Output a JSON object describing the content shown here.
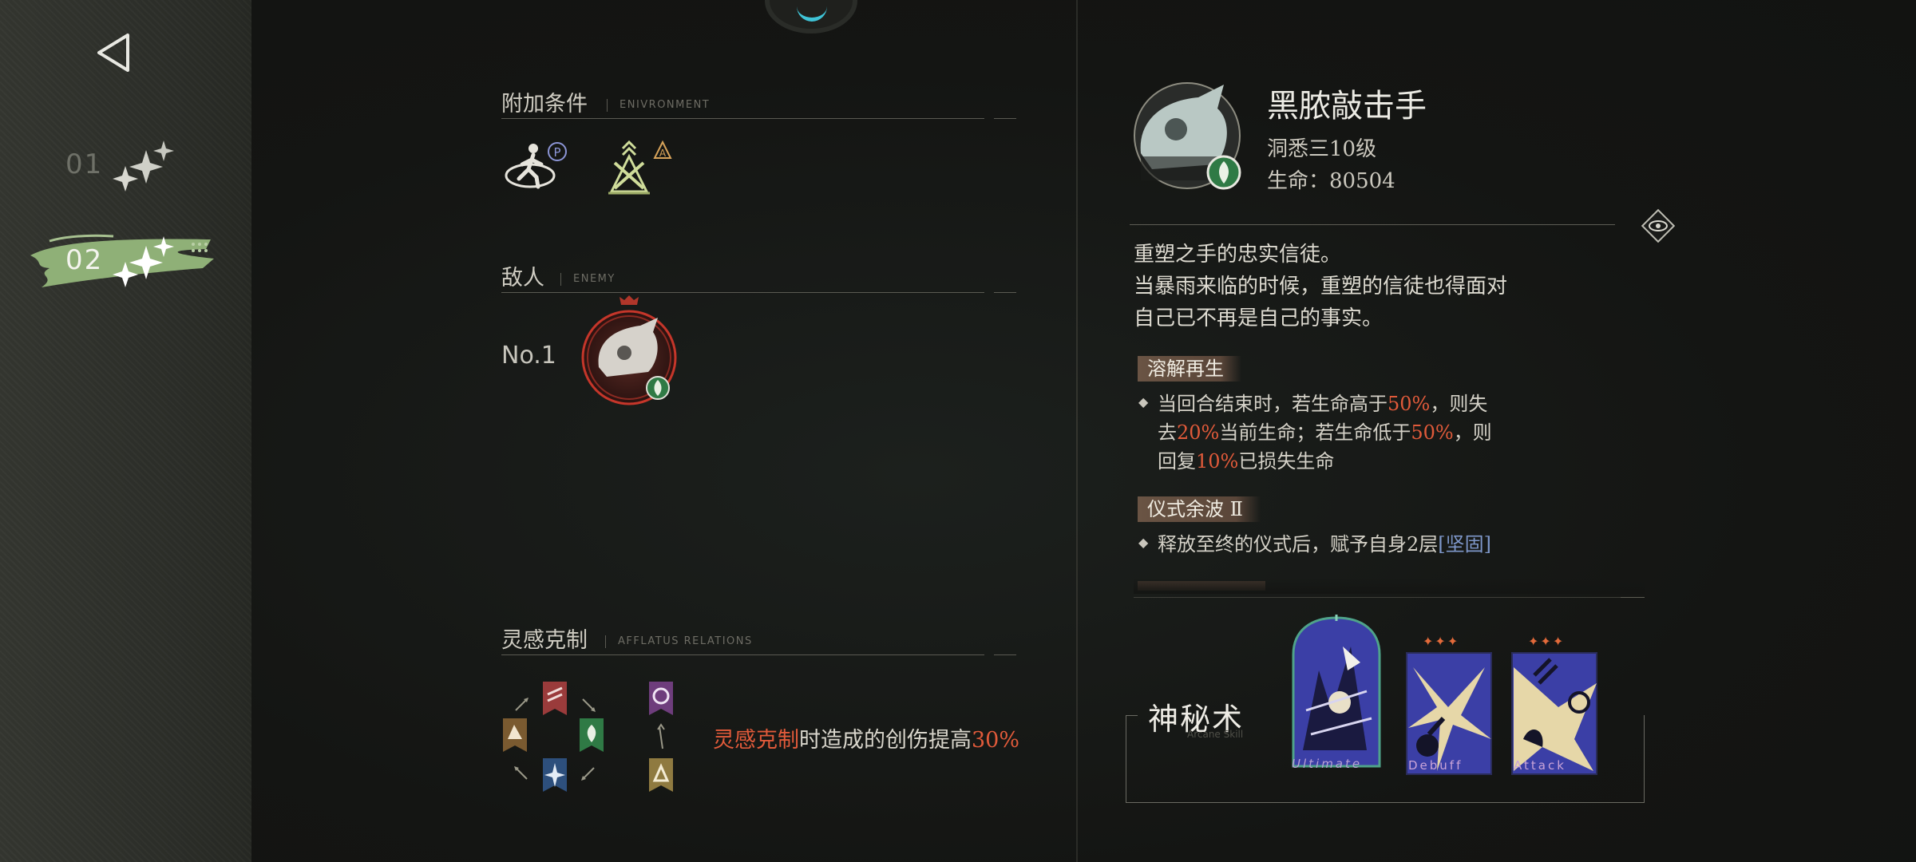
{
  "rail": {
    "stages": [
      {
        "number": "01",
        "selected": false
      },
      {
        "number": "02",
        "selected": true
      }
    ]
  },
  "environment": {
    "title": "附加条件",
    "subtitle": "ENIVRONMENT",
    "icons": [
      {
        "name": "passive-walker-icon",
        "badge": "P"
      },
      {
        "name": "altar-triangle-icon",
        "badge": "A"
      }
    ]
  },
  "enemy": {
    "title": "敌人",
    "subtitle": "ENEMY",
    "number_label": "No.1",
    "afflatus_icon": "plant-leaf-icon"
  },
  "afflatus": {
    "title": "灵感克制",
    "subtitle": "AFFLATUS RELATIONS",
    "effect_highlight": "灵感克制",
    "effect_text": "时造成的创伤提高",
    "effect_value": "30%",
    "cycle_colors": {
      "beast": "#9a3b3b",
      "plant": "#2f7a45",
      "star": "#2d4f7c",
      "mineral": "#7a5a30",
      "spirit": "#6e3d7c",
      "intellect": "#8f7a40"
    }
  },
  "boss": {
    "name": "黑脓敲击手",
    "level": "洞悉三10级",
    "hp_label": "生命：",
    "hp_value": "80504",
    "lore": [
      "重塑之手的忠实信徒。",
      "当暴雨来临的时候，重塑的信徒也得面对",
      "自己已不再是自己的事实。"
    ],
    "skills": [
      {
        "name": "溶解再生",
        "lines": [
          {
            "t1": "当回合结束时，若生命高于",
            "v1": "50%",
            "t2": "，则失"
          },
          {
            "t1": "去",
            "v1": "20%",
            "t2": "当前生命；若生命低于",
            "v2": "50%",
            "t3": "，则"
          },
          {
            "t1": "回复",
            "v1": "10%",
            "t2": "已损失生命"
          }
        ]
      },
      {
        "name": "仪式余波 Ⅱ",
        "lines": [
          {
            "t1": "释放至终的仪式后，赋予自身2层",
            "k1": "[坚固]"
          }
        ]
      }
    ]
  },
  "arcane": {
    "title": "神秘术",
    "subtitle": "Arcane Skill",
    "cards": [
      {
        "label": "Ultimate",
        "stars": "",
        "type": "ultimate"
      },
      {
        "label": "Debuff",
        "stars": "✦✦✦",
        "type": "debuff"
      },
      {
        "label": "Attack",
        "stars": "✦✦✦",
        "type": "attack"
      }
    ]
  },
  "colors": {
    "accent_red": "#e05a3a",
    "accent_blue": "#7e97c9",
    "selected_stage": "#8fb077",
    "cyan_ring": "#3fc3d6"
  }
}
